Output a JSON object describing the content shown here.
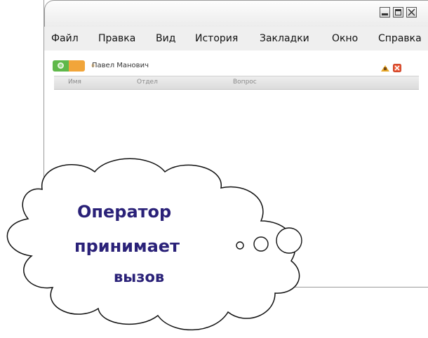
{
  "window": {
    "controls": [
      "minimize",
      "maximize",
      "close"
    ]
  },
  "menubar": {
    "items": [
      "Файл",
      "Правка",
      "Вид",
      "История",
      "Закладки",
      "Окно",
      "Справка"
    ]
  },
  "toolbar": {
    "operator_name": "Павел Манович",
    "status_colors": {
      "online": "#5fb84a",
      "away": "#f1a53a"
    },
    "icons": [
      "chat-tool-icon",
      "close-red-icon"
    ]
  },
  "table": {
    "columns": [
      "Имя",
      "Отдел",
      "Вопрос"
    ],
    "rows": []
  },
  "callout": {
    "line1": "Оператор",
    "line2": "принимает",
    "line3": "вызов",
    "text_color": "#2a2178"
  }
}
